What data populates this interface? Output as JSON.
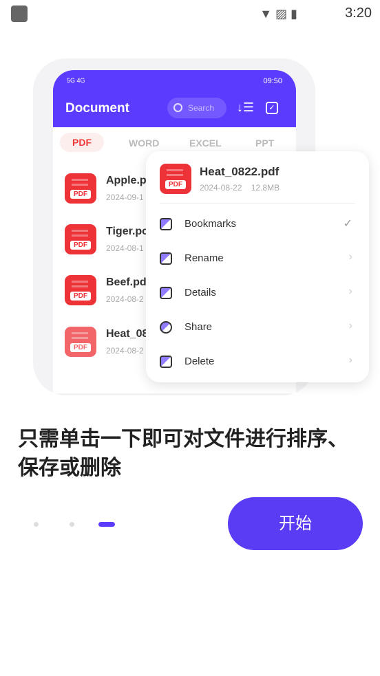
{
  "status_bar": {
    "time": "3:20"
  },
  "mockup": {
    "status": {
      "signal": "5G 4G",
      "time": "09:50"
    },
    "title": "Document",
    "search_placeholder": "Search",
    "tabs": [
      "PDF",
      "WORD",
      "EXCEL",
      "PPT"
    ],
    "files": [
      {
        "name": "Apple.p",
        "date": "2024-09-1"
      },
      {
        "name": "Tiger.pc",
        "date": "2024-08-1"
      },
      {
        "name": "Beef.pd",
        "date": "2024-08-2"
      },
      {
        "name": "Heat_08",
        "date": "2024-08-2"
      }
    ],
    "file_badge": "PDF"
  },
  "popup": {
    "file_name": "Heat_0822.pdf",
    "date": "2024-08-22",
    "size": "12.8MB",
    "items": [
      {
        "label": "Bookmarks",
        "icon": "bookmark-icon",
        "trail": "✓"
      },
      {
        "label": "Rename",
        "icon": "text-cursor-icon",
        "trail": "›"
      },
      {
        "label": "Details",
        "icon": "document-icon",
        "trail": "›"
      },
      {
        "label": "Share",
        "icon": "share-icon",
        "trail": "›"
      },
      {
        "label": "Delete",
        "icon": "trash-icon",
        "trail": "›"
      }
    ]
  },
  "headline": "只需单击一下即可对文件进行排序、保存或删除",
  "pager": {
    "count": 3,
    "active": 3
  },
  "start_button": "开始",
  "colors": {
    "accent": "#5b3cff",
    "pdf": "#ee3338"
  }
}
